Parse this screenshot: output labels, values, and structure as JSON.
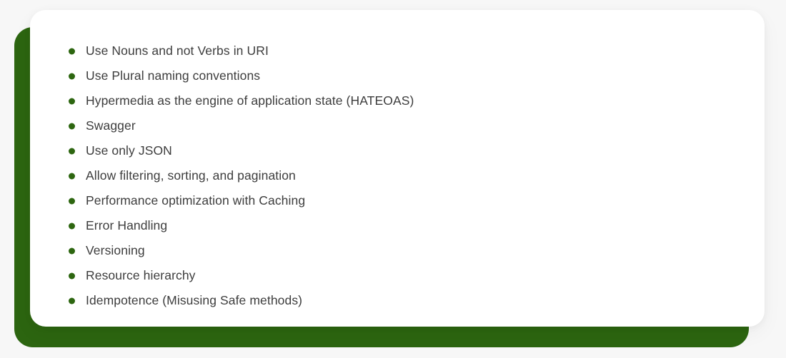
{
  "card": {
    "accent_color": "#2c6510",
    "card_background": "#ffffff",
    "page_background": "#f7f7f7",
    "text_color": "#3d3d3d",
    "bullet_color": "#2d6610"
  },
  "list": {
    "bullet_icon_name": "bullet-dot-icon",
    "items": [
      {
        "label": "Use Nouns and not Verbs in URI"
      },
      {
        "label": "Use Plural naming conventions"
      },
      {
        "label": "Hypermedia as the engine of application state (HATEOAS)"
      },
      {
        "label": "Swagger"
      },
      {
        "label": "Use only JSON"
      },
      {
        "label": "Allow filtering, sorting, and pagination"
      },
      {
        "label": "Performance optimization with Caching"
      },
      {
        "label": "Error Handling"
      },
      {
        "label": "Versioning"
      },
      {
        "label": "Resource hierarchy"
      },
      {
        "label": "Idempotence (Misusing Safe methods)"
      }
    ]
  }
}
